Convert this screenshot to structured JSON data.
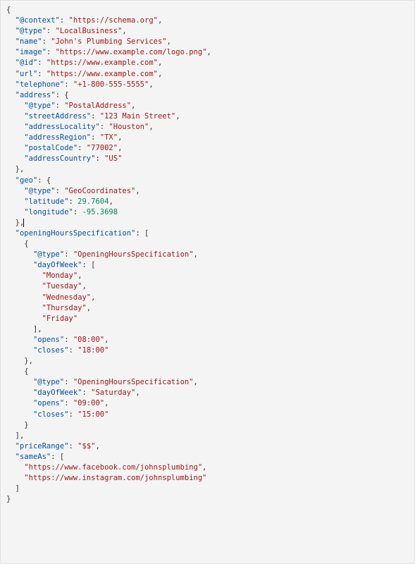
{
  "l1": "{",
  "l2k": "\"@context\"",
  "l2c": ": ",
  "l2v": "\"https://schema.org\"",
  "l2e": ",",
  "l3k": "\"@type\"",
  "l3c": ": ",
  "l3v": "\"LocalBusiness\"",
  "l3e": ",",
  "l4k": "\"name\"",
  "l4c": ": ",
  "l4v": "\"John's Plumbing Services\"",
  "l4e": ",",
  "l5k": "\"image\"",
  "l5c": ": ",
  "l5v": "\"https://www.example.com/logo.png\"",
  "l5e": ",",
  "l6k": "\"@id\"",
  "l6c": ": ",
  "l6v": "\"https://www.example.com\"",
  "l6e": ",",
  "l7k": "\"url\"",
  "l7c": ": ",
  "l7v": "\"https://www.example.com\"",
  "l7e": ",",
  "l8k": "\"telephone\"",
  "l8c": ": ",
  "l8v": "\"+1-800-555-5555\"",
  "l8e": ",",
  "l9k": "\"address\"",
  "l9c": ": {",
  "l10k": "\"@type\"",
  "l10c": ": ",
  "l10v": "\"PostalAddress\"",
  "l10e": ",",
  "l11k": "\"streetAddress\"",
  "l11c": ": ",
  "l11v": "\"123 Main Street\"",
  "l11e": ",",
  "l12k": "\"addressLocality\"",
  "l12c": ": ",
  "l12v": "\"Houston\"",
  "l12e": ",",
  "l13k": "\"addressRegion\"",
  "l13c": ": ",
  "l13v": "\"TX\"",
  "l13e": ",",
  "l14k": "\"postalCode\"",
  "l14c": ": ",
  "l14v": "\"77002\"",
  "l14e": ",",
  "l15k": "\"addressCountry\"",
  "l15c": ": ",
  "l15v": "\"US\"",
  "l16": "},",
  "l17k": "\"geo\"",
  "l17c": ": {",
  "l18k": "\"@type\"",
  "l18c": ": ",
  "l18v": "\"GeoCoordinates\"",
  "l18e": ",",
  "l19k": "\"latitude\"",
  "l19c": ": ",
  "l19v": "29.7604",
  "l19e": ",",
  "l20k": "\"longitude\"",
  "l20c": ": ",
  "l20v": "-95.3698",
  "l21": "},",
  "l22k": "\"openingHoursSpecification\"",
  "l22c": ": [",
  "l23": "{",
  "l24k": "\"@type\"",
  "l24c": ": ",
  "l24v": "\"OpeningHoursSpecification\"",
  "l24e": ",",
  "l25k": "\"dayOfWeek\"",
  "l25c": ": [",
  "l26v": "\"Monday\"",
  "l26e": ",",
  "l27v": "\"Tuesday\"",
  "l27e": ",",
  "l28v": "\"Wednesday\"",
  "l28e": ",",
  "l29v": "\"Thursday\"",
  "l29e": ",",
  "l30v": "\"Friday\"",
  "l31": "],",
  "l32k": "\"opens\"",
  "l32c": ": ",
  "l32v": "\"08:00\"",
  "l32e": ",",
  "l33k": "\"closes\"",
  "l33c": ": ",
  "l33v": "\"18:00\"",
  "l34": "},",
  "l35": "{",
  "l36k": "\"@type\"",
  "l36c": ": ",
  "l36v": "\"OpeningHoursSpecification\"",
  "l36e": ",",
  "l37k": "\"dayOfWeek\"",
  "l37c": ": ",
  "l37v": "\"Saturday\"",
  "l37e": ",",
  "l38k": "\"opens\"",
  "l38c": ": ",
  "l38v": "\"09:00\"",
  "l38e": ",",
  "l39k": "\"closes\"",
  "l39c": ": ",
  "l39v": "\"15:00\"",
  "l40": "}",
  "l41": "],",
  "l42k": "\"priceRange\"",
  "l42c": ": ",
  "l42v": "\"$$\"",
  "l42e": ",",
  "l43k": "\"sameAs\"",
  "l43c": ": [",
  "l44v": "\"https://www.facebook.com/johnsplumbing\"",
  "l44e": ",",
  "l45v": "\"https://www.instagram.com/johnsplumbing\"",
  "l46": "]",
  "l47": "}"
}
